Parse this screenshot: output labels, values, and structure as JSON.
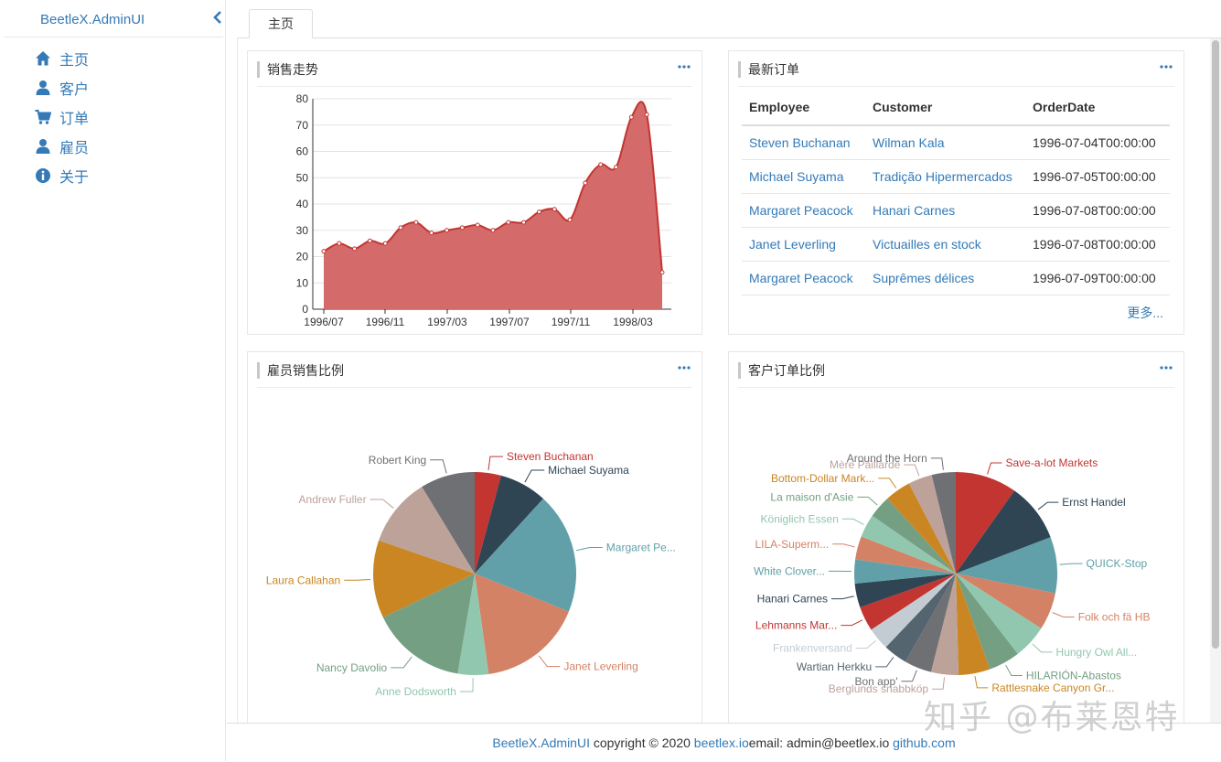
{
  "brand": {
    "title": "BeetleX.AdminUI"
  },
  "sidebar": {
    "items": [
      {
        "label": "主页",
        "icon": "home-icon"
      },
      {
        "label": "客户",
        "icon": "user-icon"
      },
      {
        "label": "订单",
        "icon": "cart-icon"
      },
      {
        "label": "雇员",
        "icon": "user-icon"
      },
      {
        "label": "关于",
        "icon": "info-icon"
      }
    ]
  },
  "tabs": [
    {
      "label": "主页"
    }
  ],
  "panels": {
    "sales_trend": {
      "title": "销售走势"
    },
    "latest_orders": {
      "title": "最新订单",
      "columns": [
        "Employee",
        "Customer",
        "OrderDate"
      ],
      "rows": [
        [
          "Steven Buchanan",
          "Wilman Kala",
          "1996-07-04T00:00:00"
        ],
        [
          "Michael Suyama",
          "Tradição Hipermercados",
          "1996-07-05T00:00:00"
        ],
        [
          "Margaret Peacock",
          "Hanari Carnes",
          "1996-07-08T00:00:00"
        ],
        [
          "Janet Leverling",
          "Victuailles en stock",
          "1996-07-08T00:00:00"
        ],
        [
          "Margaret Peacock",
          "Suprêmes délices",
          "1996-07-09T00:00:00"
        ]
      ],
      "more": "更多..."
    },
    "employee_share": {
      "title": "雇员销售比例"
    },
    "customer_share": {
      "title": "客户订单比例"
    }
  },
  "colors": {
    "accent": "#337ab7",
    "area_fill": "#d56a6a",
    "area_line": "#c23531"
  },
  "chart_data": [
    {
      "type": "area",
      "x_ticks": [
        "1996/07",
        "1996/11",
        "1997/03",
        "1997/07",
        "1997/11",
        "1998/03"
      ],
      "ylim": [
        0,
        80
      ],
      "y_ticks": [
        "0",
        "10",
        "20",
        "30",
        "40",
        "50",
        "60",
        "70",
        "80"
      ],
      "grid": true,
      "series": [
        {
          "values": [
            22,
            25,
            23,
            26,
            25,
            31,
            33,
            29,
            30,
            31,
            32,
            30,
            33,
            33,
            37,
            38,
            34,
            48,
            55,
            54,
            73,
            74,
            14
          ]
        }
      ]
    },
    {
      "type": "pie",
      "labels": [
        "Steven Buchanan",
        "Michael Suyama",
        "Margaret Pe...",
        "Janet Leverling",
        "Anne Dodsworth",
        "Nancy Davolio",
        "Laura Callahan",
        "Andrew Fuller",
        "Robert King"
      ],
      "values": [
        4.2,
        7.6,
        19.3,
        16.7,
        4.9,
        15.2,
        12.4,
        11.0,
        8.7
      ],
      "colors": [
        "#c23531",
        "#2f4554",
        "#61a0a8",
        "#d48265",
        "#91c7ae",
        "#749f83",
        "#ca8622",
        "#bda29a",
        "#6e7074"
      ]
    },
    {
      "type": "pie",
      "labels": [
        "Save-a-lot Markets",
        "Ernst Handel",
        "QUICK-Stop",
        "Folk och fä HB",
        "Hungry Owl All...",
        "HILARIÓN-Abastos",
        "Rattlesnake Canyon Gr...",
        "Berglunds snabbköp",
        "Bon app'",
        "Wartian Herkku",
        "Frankenversand",
        "Lehmanns Mar...",
        "Hanari Carnes",
        "White Clover...",
        "LILA-Superm...",
        "Königlich Essen",
        "La maison d'Asie",
        "Bottom-Dollar Mark...",
        "Mère Paillarde",
        "Around the Horn"
      ],
      "values": [
        9.0,
        8.6,
        8.2,
        5.5,
        5.0,
        4.6,
        4.6,
        4.0,
        4.0,
        3.5,
        3.3,
        3.6,
        3.5,
        3.5,
        3.4,
        3.4,
        3.3,
        3.8,
        3.5,
        3.5
      ],
      "colors": [
        "#c23531",
        "#2f4554",
        "#61a0a8",
        "#d48265",
        "#91c7ae",
        "#749f83",
        "#ca8622",
        "#bda29a",
        "#6e7074",
        "#546570",
        "#c4ccd3",
        "#c23531",
        "#2f4554",
        "#61a0a8",
        "#d48265",
        "#91c7ae",
        "#749f83",
        "#ca8622",
        "#bda29a",
        "#6e7074"
      ]
    }
  ],
  "footer": {
    "brand": "BeetleX.AdminUI",
    "copyright": " copyright © 2020 ",
    "site": "beetlex.io",
    "email": "email: admin@beetlex.io ",
    "github": "github.com"
  },
  "watermark": "知乎 @布莱恩特"
}
